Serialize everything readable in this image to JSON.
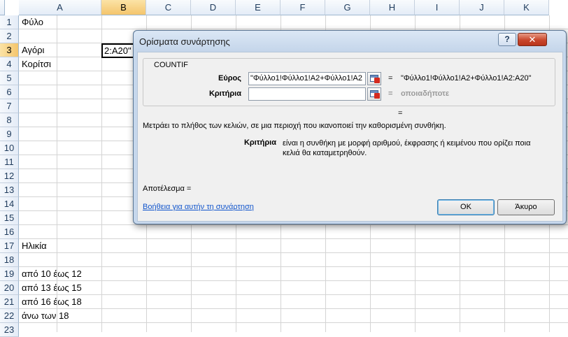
{
  "sheet": {
    "columns": [
      "A",
      "B",
      "C",
      "D",
      "E",
      "F",
      "G",
      "H",
      "I",
      "J",
      "K"
    ],
    "rows": [
      "1",
      "2",
      "3",
      "4",
      "5",
      "6",
      "7",
      "8",
      "9",
      "10",
      "11",
      "12",
      "13",
      "14",
      "15",
      "16",
      "17",
      "18",
      "19",
      "20",
      "21",
      "22",
      "23"
    ],
    "selected_column": "B",
    "selected_row": "3",
    "cells": {
      "A1": "Φύλο",
      "A3": "Αγόρι",
      "A4": "Κορίτσι",
      "A17": "Ηλικία",
      "A19": "από 10 έως 12",
      "A20": "από 13 έως 15",
      "A21": "από 16 έως 18",
      "A22": "άνω των 18"
    },
    "active_cell_text": "2:A20\""
  },
  "dialog": {
    "title": "Ορίσματα συνάρτησης",
    "help_label": "?",
    "close_label": "✕",
    "function_name": "COUNTIF",
    "args": [
      {
        "label": "Εύρος",
        "value": "\"Φύλλο1!Φύλλο1!A2+Φύλλο1!A2",
        "equals": "=",
        "result": "\"Φύλλο1!Φύλλο1!A2+Φύλλο1!A2:A20\""
      },
      {
        "label": "Κριτήρια",
        "value": "",
        "equals": "=",
        "result": "οποιαδήποτε"
      }
    ],
    "formula_result_equals": "=",
    "description": "Μετράει το πλήθος των κελιών, σε μια περιοχή που ικανοποιεί την καθορισμένη συνθήκη.",
    "arg_help_label": "Κριτήρια",
    "arg_help_text": "είναι η συνθήκη με μορφή αριθμού, έκφρασης ή κειμένου που ορίζει ποια κελιά θα καταμετρηθούν.",
    "result_label": "Αποτέλεσμα =",
    "help_link": "Βοήθεια για αυτήν τη συνάρτηση",
    "ok_label": "OK",
    "cancel_label": "Άκυρο"
  },
  "colors": {
    "arrow": "#e8201a",
    "selected_header": "#f4c56c",
    "dialog_frame": "#c6d7ec"
  },
  "icons": [
    "ref-collapse-icon",
    "red-arrow-icon"
  ]
}
